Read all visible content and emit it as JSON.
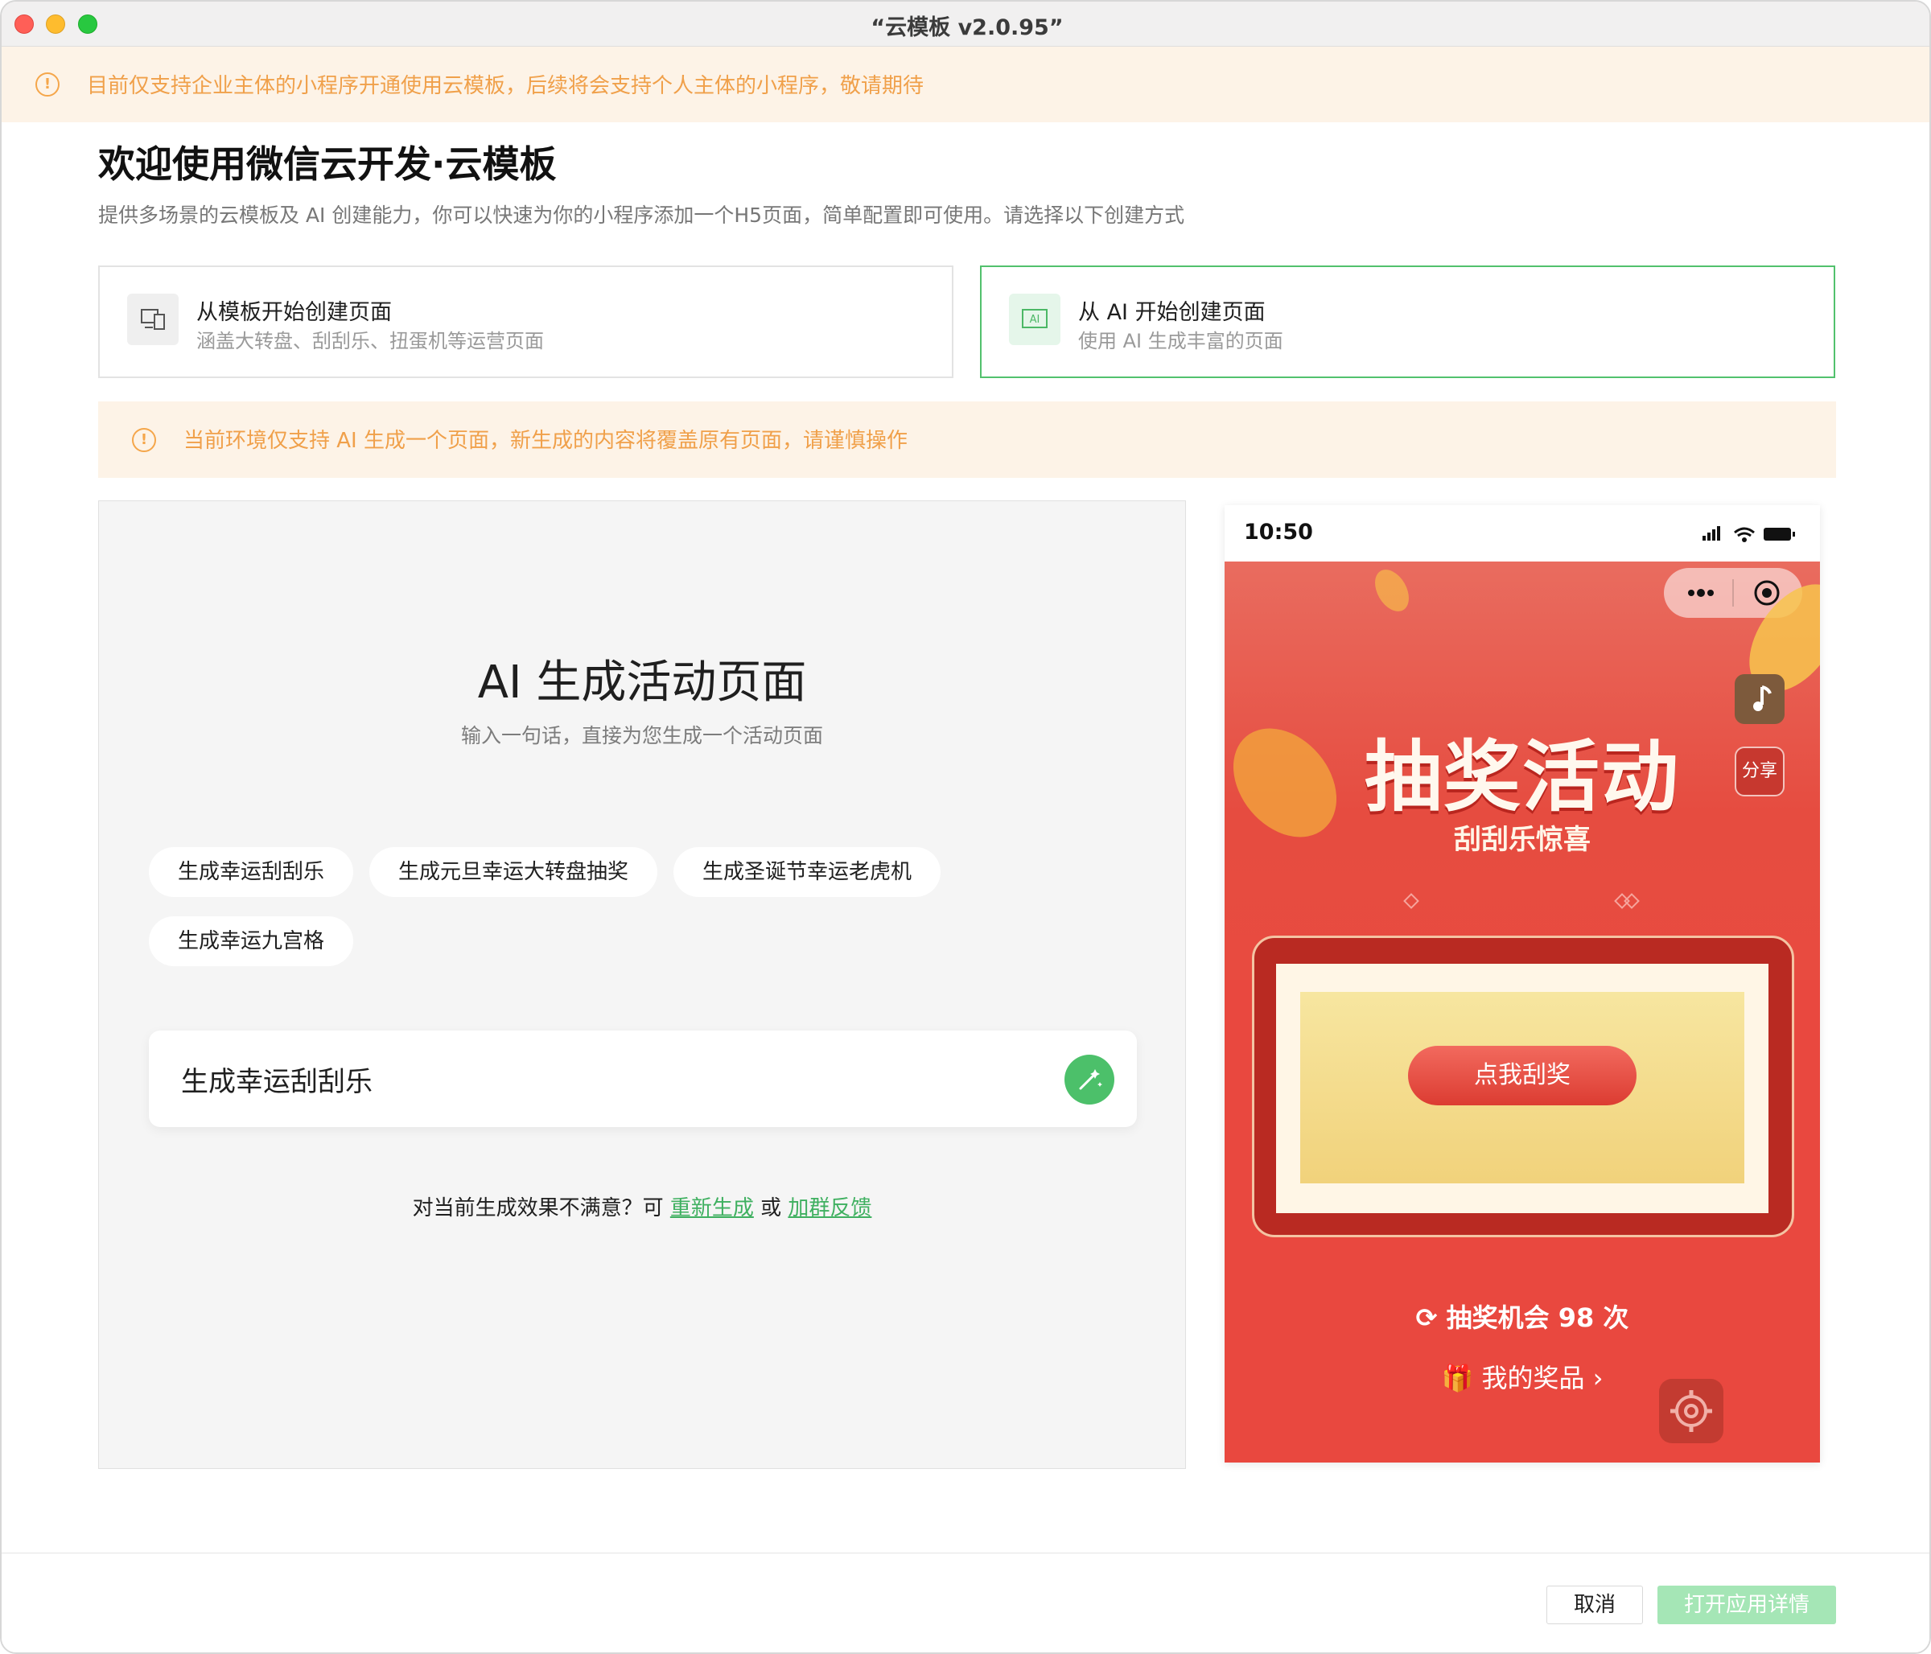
{
  "window": {
    "title": "“云模板 v2.0.95”"
  },
  "top_notice": {
    "text": "目前仅支持企业主体的小程序开通使用云模板，后续将会支持个人主体的小程序，敬请期待",
    "icon": "warning-circle-icon"
  },
  "header": {
    "title": "欢迎使用微信云开发·云模板",
    "subtitle": "提供多场景的云模板及 AI 创建能力，你可以快速为你的小程序添加一个H5页面，简单配置即可使用。请选择以下创建方式"
  },
  "options": [
    {
      "title": "从模板开始创建页面",
      "desc": "涵盖大转盘、刮刮乐、扭蛋机等运营页面",
      "icon": "template-devices-icon",
      "selected": false
    },
    {
      "title": "从 AI 开始创建页面",
      "desc": "使用 AI 生成丰富的页面",
      "icon": "ai-icon",
      "icon_label": "AI",
      "selected": true
    }
  ],
  "env_notice": {
    "text": "当前环境仅支持 AI 生成一个页面，新生成的内容将覆盖原有页面，请谨慎操作"
  },
  "ai_panel": {
    "title": "AI 生成活动页面",
    "desc": "输入一句话，直接为您生成一个活动页面",
    "suggestions": [
      "生成幸运刮刮乐",
      "生成元旦幸运大转盘抽奖",
      "生成圣诞节幸运老虎机",
      "生成幸运九宫格"
    ],
    "input_value": "生成幸运刮刮乐",
    "feedback": {
      "prefix": "对当前生成效果不满意？可",
      "regenerate": "重新生成",
      "or": "或",
      "join_group": "加群反馈"
    }
  },
  "preview": {
    "time": "10:50",
    "title": "抽奖活动",
    "subtitle": "刮刮乐惊喜",
    "share": "分享",
    "scratch_button": "点我刮奖",
    "chances": "抽奖机会 98 次",
    "my_prizes": "我的奖品"
  },
  "footer": {
    "cancel": "取消",
    "open_details": "打开应用详情"
  },
  "colors": {
    "accent_green": "#52c16d",
    "warning_orange": "#f0a04a",
    "warning_bg": "#fdf3e7",
    "phone_red": "#e9483f"
  }
}
